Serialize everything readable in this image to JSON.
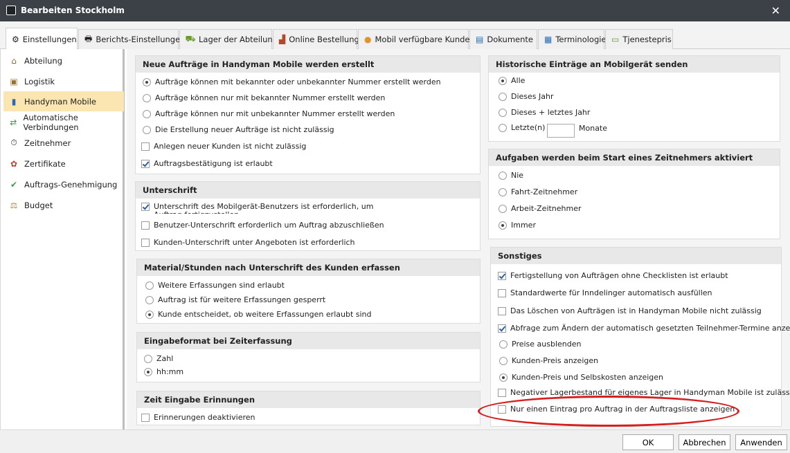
{
  "window": {
    "title": "Bearbeiten Stockholm",
    "close_symbol": "✕"
  },
  "tabs": [
    {
      "label": "Einstellungen",
      "icon": "gear-icon"
    },
    {
      "label": "Berichts-Einstellungen",
      "icon": "printer-icon"
    },
    {
      "label": "Lager der Abteilung",
      "icon": "truck-icon"
    },
    {
      "label": "Online Bestellung",
      "icon": "factory-icon"
    },
    {
      "label": "Mobil verfügbare Kunden",
      "icon": "person-icon"
    },
    {
      "label": "Dokumente",
      "icon": "document-icon"
    },
    {
      "label": "Terminologie",
      "icon": "dictionary-icon"
    },
    {
      "label": "Tjenestepris",
      "icon": "money-icon"
    }
  ],
  "sidebar": {
    "items": [
      {
        "label": "Abteilung",
        "icon": "building-icon"
      },
      {
        "label": "Logistik",
        "icon": "box-icon"
      },
      {
        "label": "Handyman Mobile",
        "icon": "phone-icon",
        "active": true
      },
      {
        "label": "Automatische Verbindungen",
        "icon": "arrows-icon"
      },
      {
        "label": "Zeitnehmer",
        "icon": "stopwatch-icon"
      },
      {
        "label": "Zertifikate",
        "icon": "ribbon-icon"
      },
      {
        "label": "Auftrags-Genehmigung",
        "icon": "check-circle-icon"
      },
      {
        "label": "Budget",
        "icon": "scale-icon"
      }
    ]
  },
  "groups": {
    "neue_auftraege": {
      "title": "Neue Aufträge in Handyman Mobile werden erstellt",
      "options": [
        "Aufträge können mit bekannter oder unbekannter Nummer erstellt werden",
        "Aufträge können nur mit bekannter Nummer erstellt werden",
        "Aufträge können nur mit unbekannter Nummer erstellt werden",
        "Die Erstellung neuer Aufträge ist nicht zulässig",
        "Anlegen neuer Kunden ist nicht zulässig",
        "Auftragsbestätigung ist erlaubt"
      ]
    },
    "unterschrift": {
      "title": "Unterschrift",
      "options": [
        "Unterschrift des Mobilgerät-Benutzers ist erforderlich, um Auftrag fertigzustellen",
        "Benutzer-Unterschrift erforderlich um Auftrag abzuschließen",
        "Kunden-Unterschrift unter Angeboten ist erforderlich"
      ]
    },
    "material": {
      "title": "Material/Stunden nach Unterschrift des Kunden erfassen",
      "options": [
        "Weitere Erfassungen sind erlaubt",
        "Auftrag ist für weitere Erfassungen gesperrt",
        "Kunde entscheidet, ob weitere Erfassungen erlaubt sind"
      ]
    },
    "eingabeformat": {
      "title": "Eingabeformat bei Zeiterfassung",
      "options": [
        "Zahl",
        "hh:mm"
      ]
    },
    "erinnerungen": {
      "title": "Zeit Eingabe Erinnungen",
      "options": [
        "Erinnerungen deaktivieren"
      ]
    },
    "historische": {
      "title": "Historische Einträge an Mobilgerät senden",
      "options": [
        "Alle",
        "Dieses Jahr",
        "Dieses + letztes Jahr",
        "Letzte(n)"
      ],
      "months_value": "",
      "months_label": "Monate"
    },
    "aufgaben": {
      "title": "Aufgaben werden beim Start eines Zeitnehmers aktiviert",
      "options": [
        "Nie",
        "Fahrt-Zeitnehmer",
        "Arbeit-Zeitnehmer",
        "Immer"
      ]
    },
    "sonstiges": {
      "title": "Sonstiges",
      "options": [
        "Fertigstellung von Aufträgen ohne Checklisten ist erlaubt",
        "Standardwerte für Inndelinger automatisch ausfüllen",
        "Das Löschen von Aufträgen ist in Handyman Mobile nicht zulässig",
        "Abfrage zum Ändern der automatisch gesetzten Teilnehmer-Termine anzeigen",
        "Preise ausblenden",
        "Kunden-Preis anzeigen",
        "Kunden-Preis und Selbskosten anzeigen",
        "Negativer Lagerbestand für eigenes Lager in Handyman Mobile ist zulässig",
        "Nur einen Eintrag pro Auftrag in der Auftragsliste anzeigen"
      ]
    }
  },
  "buttons": {
    "ok": "OK",
    "cancel": "Abbrechen",
    "apply": "Anwenden"
  },
  "colors": {
    "titlebar": "#3c4148",
    "active_sidebar": "#fbe5b0",
    "highlight_ellipse": "#d61f1f"
  }
}
